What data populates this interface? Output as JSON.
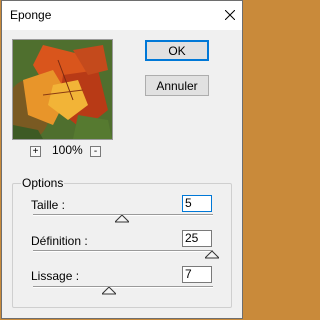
{
  "window": {
    "title": "Eponge"
  },
  "buttons": {
    "ok": "OK",
    "cancel": "Annuler"
  },
  "zoom": {
    "in": "+",
    "out": "-",
    "level": "100%"
  },
  "options": {
    "legend": "Options",
    "params": [
      {
        "label": "Taille :",
        "value": "5",
        "slider_fraction": 0.55
      },
      {
        "label": "Définition :",
        "value": "25",
        "slider_fraction": 1.0
      },
      {
        "label": "Lissage :",
        "value": "7",
        "slider_fraction": 0.45
      }
    ]
  },
  "icons": {
    "close": "close-icon",
    "preview": "autumn-leaves-preview-image"
  },
  "colors": {
    "accent": "#0078d7",
    "background": "#f0f0f0",
    "titlebar": "#ffffff"
  }
}
